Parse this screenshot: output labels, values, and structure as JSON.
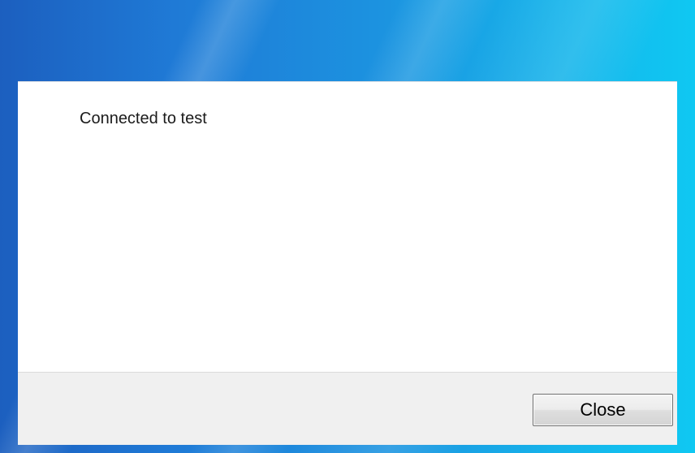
{
  "dialog": {
    "message": "Connected to test",
    "close_label": "Close"
  },
  "theme": {
    "frame_left": "#1c5fbf",
    "frame_right": "#0fc8f2",
    "content_bg": "#ffffff",
    "footer_bg": "#f0f0f0"
  }
}
